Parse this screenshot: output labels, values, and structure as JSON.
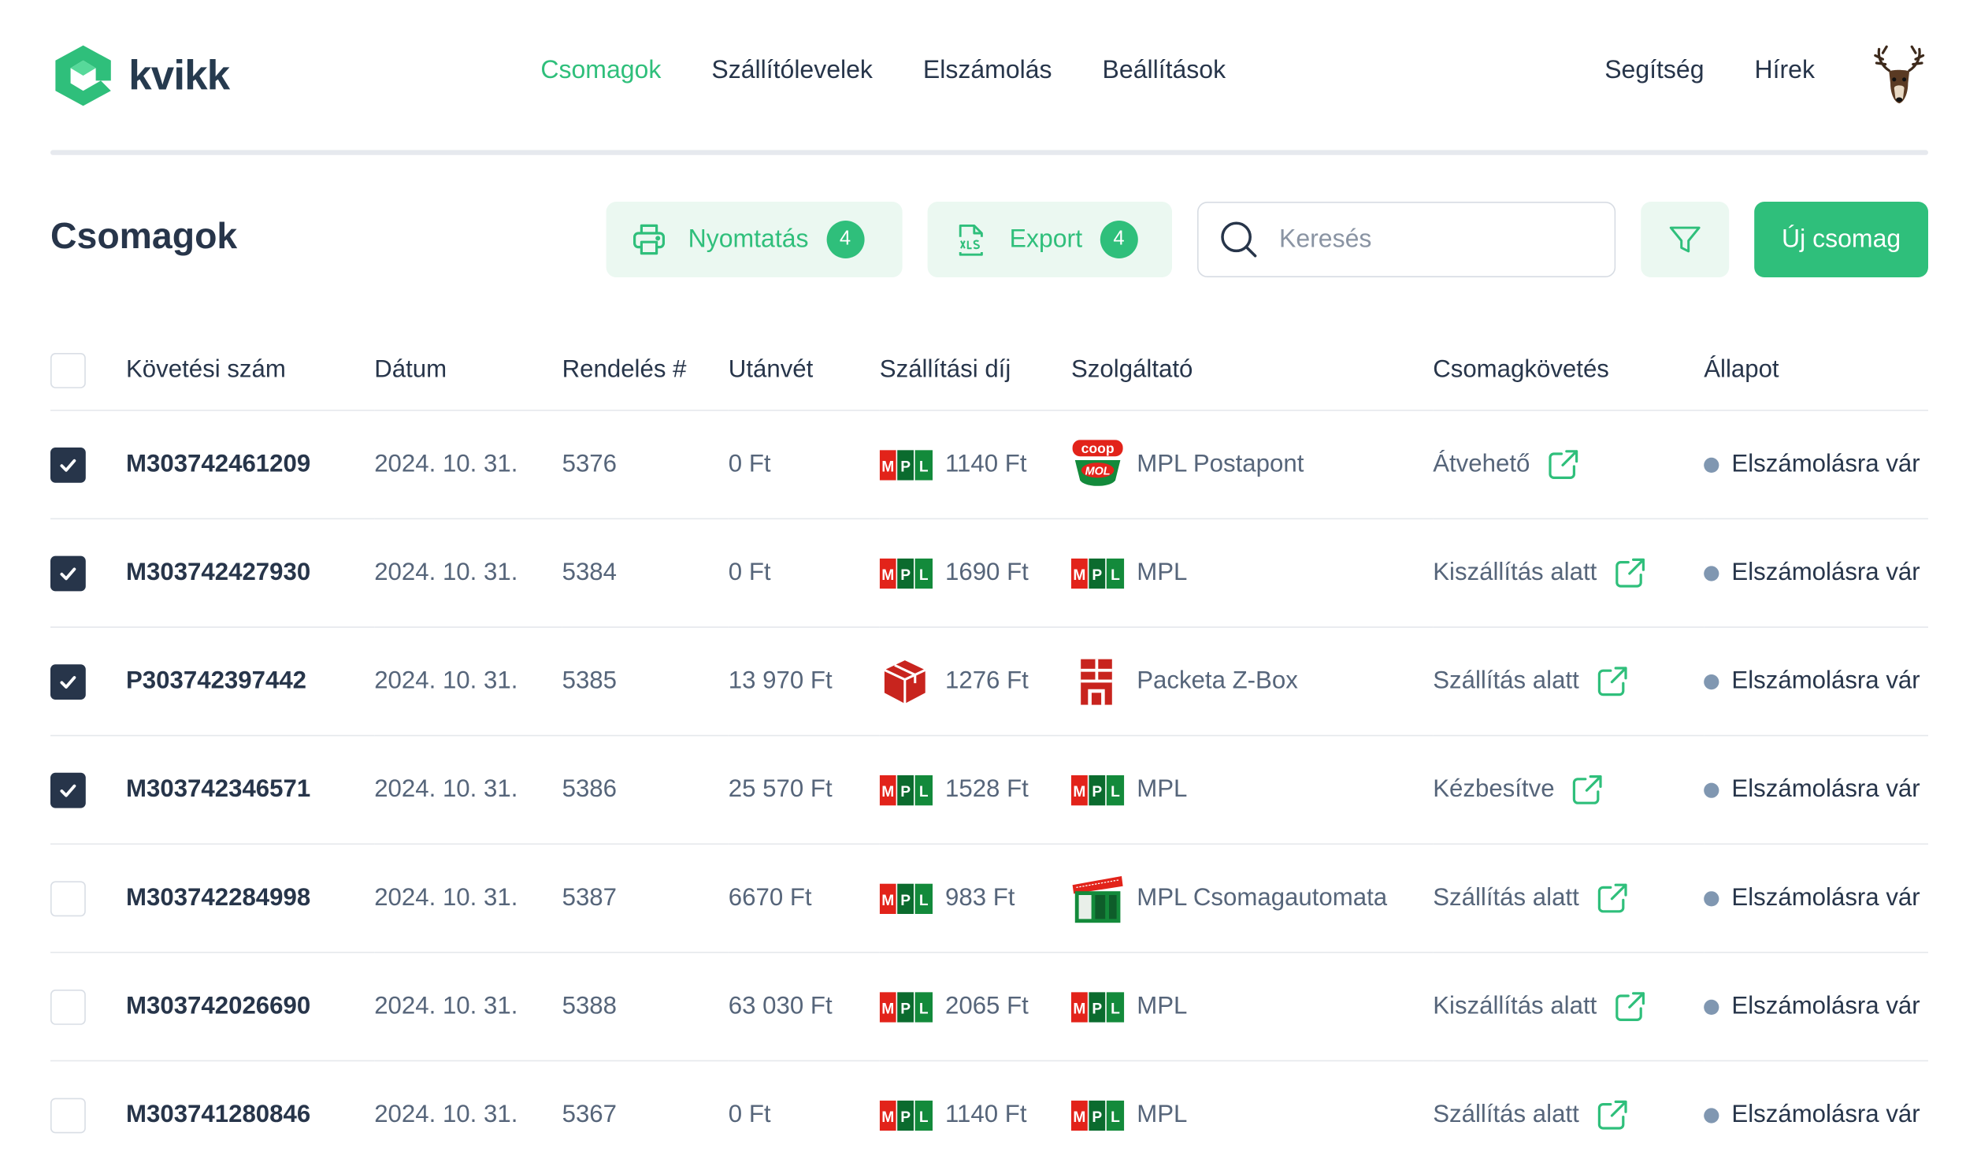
{
  "app": {
    "name": "kvikk"
  },
  "nav": {
    "items": [
      "Csomagok",
      "Szállítólevelek",
      "Elszámolás",
      "Beállítások"
    ],
    "active": "Csomagok",
    "help": "Segítség",
    "news": "Hírek"
  },
  "page": {
    "title": "Csomagok"
  },
  "toolbar": {
    "print_label": "Nyomtatás",
    "print_count": "4",
    "export_label": "Export",
    "export_count": "4",
    "search_placeholder": "Keresés",
    "search_value": "",
    "new_label": "Új csomag"
  },
  "table": {
    "columns": [
      "Követési szám",
      "Dátum",
      "Rendelés #",
      "Utánvét",
      "Szállítási díj",
      "Szolgáltató",
      "Csomagkövetés",
      "Állapot"
    ],
    "rows": [
      {
        "checked": true,
        "tracking": "M303742461209",
        "date": "2024. 10. 31.",
        "order": "5376",
        "cod": "0 Ft",
        "carrier_icon": "mpl-icon",
        "fee": "1140 Ft",
        "provider_icon": "coop-mol-icon",
        "provider": "MPL Postapont",
        "track_status": "Átvehető",
        "status": "Elszámolásra vár"
      },
      {
        "checked": true,
        "tracking": "M303742427930",
        "date": "2024. 10. 31.",
        "order": "5384",
        "cod": "0 Ft",
        "carrier_icon": "mpl-icon",
        "fee": "1690 Ft",
        "provider_icon": "mpl-icon",
        "provider": "MPL",
        "track_status": "Kiszállítás alatt",
        "status": "Elszámolásra vár"
      },
      {
        "checked": true,
        "tracking": "P303742397442",
        "date": "2024. 10. 31.",
        "order": "5385",
        "cod": "13 970 Ft",
        "carrier_icon": "packeta-icon",
        "fee": "1276 Ft",
        "provider_icon": "packeta-zbox-icon",
        "provider": "Packeta Z-Box",
        "track_status": "Szállítás alatt",
        "status": "Elszámolásra vár"
      },
      {
        "checked": true,
        "tracking": "M303742346571",
        "date": "2024. 10. 31.",
        "order": "5386",
        "cod": "25 570 Ft",
        "carrier_icon": "mpl-icon",
        "fee": "1528 Ft",
        "provider_icon": "mpl-icon",
        "provider": "MPL",
        "track_status": "Kézbesítve",
        "status": "Elszámolásra vár"
      },
      {
        "checked": false,
        "tracking": "M303742284998",
        "date": "2024. 10. 31.",
        "order": "5387",
        "cod": "6670 Ft",
        "carrier_icon": "mpl-icon",
        "fee": "983 Ft",
        "provider_icon": "parcel-locker-icon",
        "provider": "MPL Csomagautomata",
        "track_status": "Szállítás alatt",
        "status": "Elszámolásra vár"
      },
      {
        "checked": false,
        "tracking": "M303742026690",
        "date": "2024. 10. 31.",
        "order": "5388",
        "cod": "63 030 Ft",
        "carrier_icon": "mpl-icon",
        "fee": "2065 Ft",
        "provider_icon": "mpl-icon",
        "provider": "MPL",
        "track_status": "Kiszállítás alatt",
        "status": "Elszámolásra vár"
      },
      {
        "checked": false,
        "tracking": "M303741280846",
        "date": "2024. 10. 31.",
        "order": "5367",
        "cod": "0 Ft",
        "carrier_icon": "mpl-icon",
        "fee": "1140 Ft",
        "provider_icon": "mpl-icon",
        "provider": "MPL",
        "track_status": "Szállítás alatt",
        "status": "Elszámolásra vár"
      }
    ]
  },
  "colors": {
    "accent": "#2fbf7b",
    "accent_light": "#ebf8f1",
    "text": "#27354a",
    "muted": "#56657a",
    "status_dot": "#8097b1",
    "mpl_red": "#e2231a",
    "mpl_green": "#138a3b",
    "mpl_dark": "#0b6b2e",
    "packeta_red": "#c8241e"
  }
}
